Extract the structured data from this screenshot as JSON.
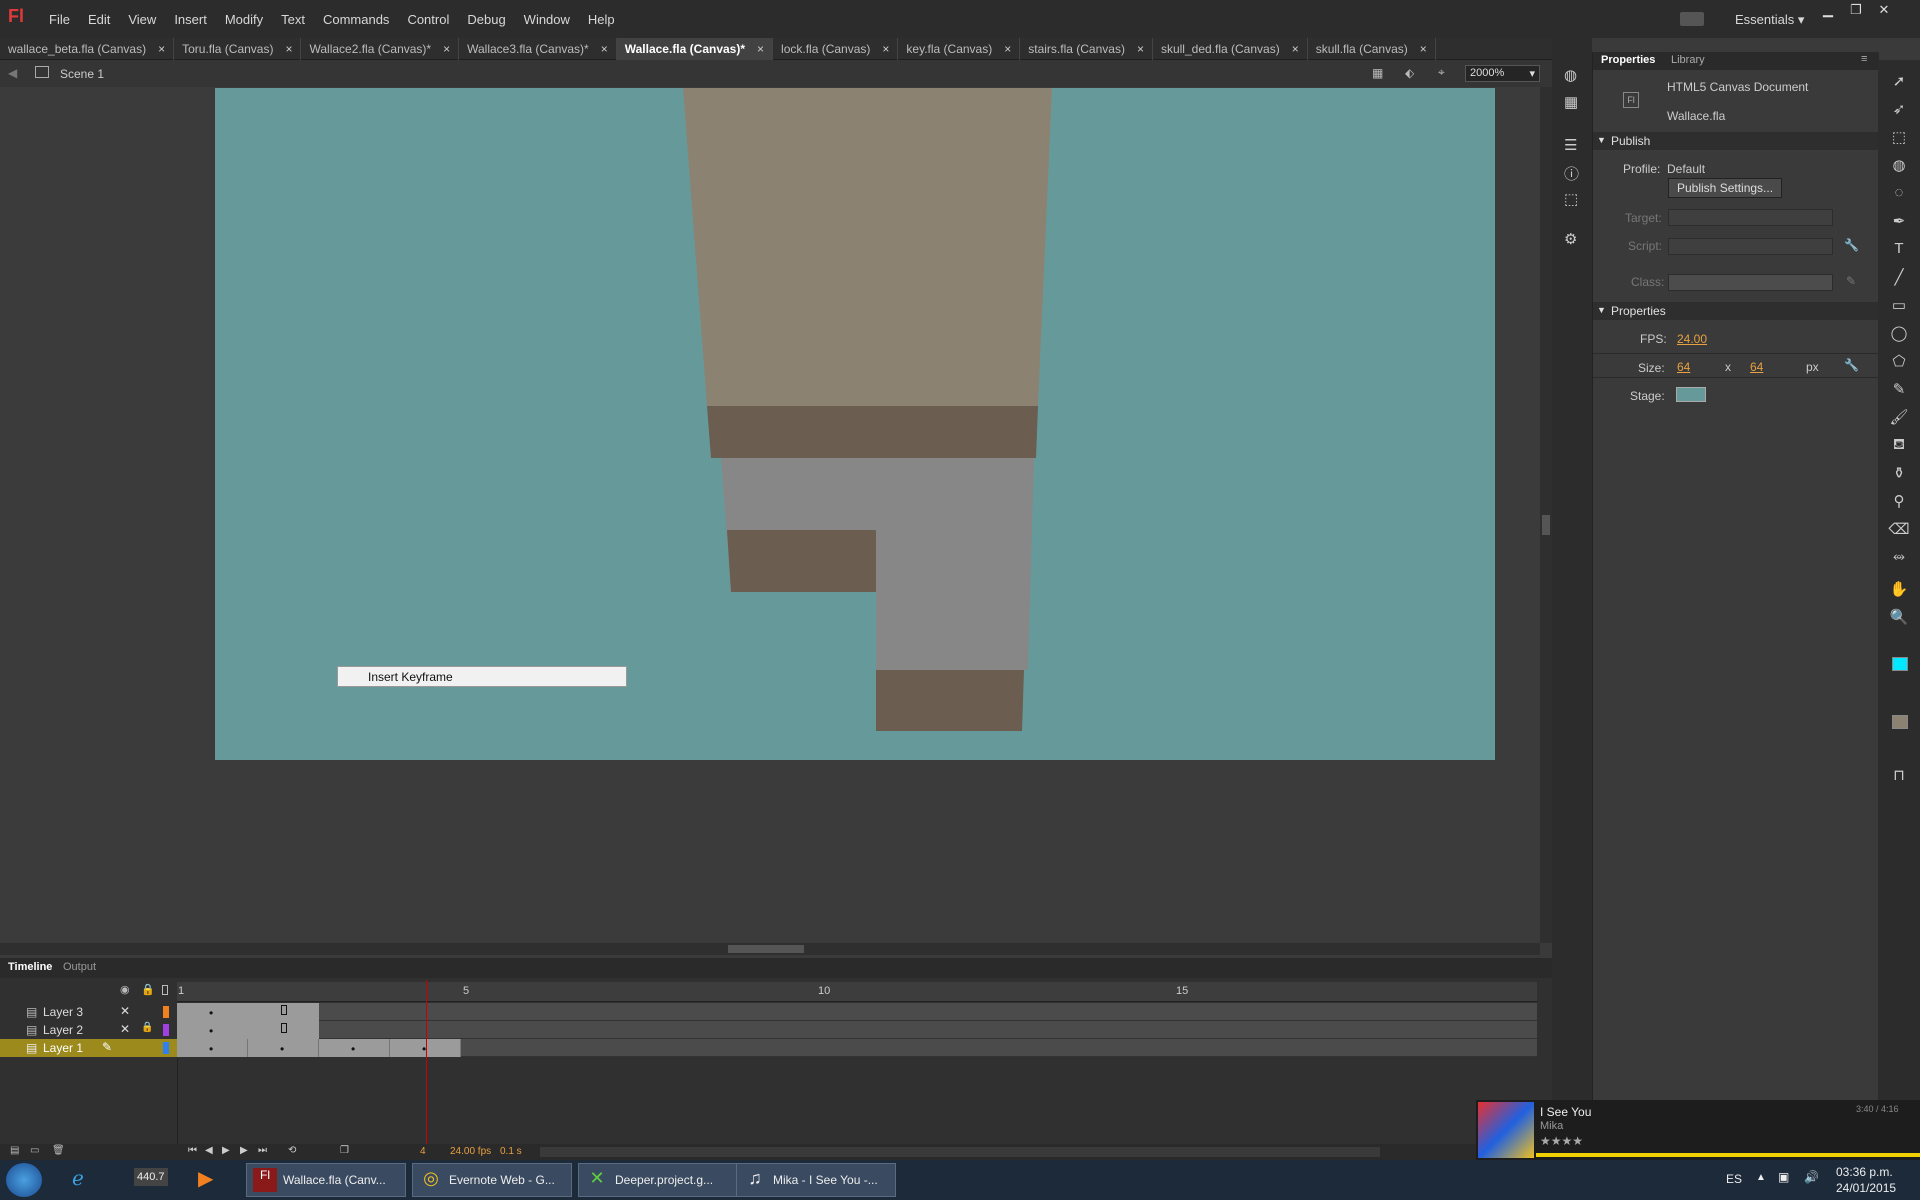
{
  "app": {
    "logo": "Fl",
    "workspace": "Essentials"
  },
  "menus": [
    "File",
    "Edit",
    "View",
    "Insert",
    "Modify",
    "Text",
    "Commands",
    "Control",
    "Debug",
    "Window",
    "Help"
  ],
  "tabs": [
    {
      "label": "wallace_beta.fla (Canvas)"
    },
    {
      "label": "Toru.fla (Canvas)"
    },
    {
      "label": "Wallace2.fla (Canvas)*"
    },
    {
      "label": "Wallace3.fla (Canvas)*"
    },
    {
      "label": "Wallace.fla (Canvas)*",
      "active": true
    },
    {
      "label": "lock.fla (Canvas)"
    },
    {
      "label": "key.fla (Canvas)"
    },
    {
      "label": "stairs.fla (Canvas)"
    },
    {
      "label": "skull_ded.fla (Canvas)"
    },
    {
      "label": "skull.fla (Canvas)"
    }
  ],
  "tab_close": "×",
  "editbar": {
    "scene": "Scene 1",
    "zoom": "2000%"
  },
  "context_menu": {
    "item": "Insert Keyframe"
  },
  "colors": {
    "stage": "#669a9a",
    "tan": "#8c8272",
    "brown": "#6b5d4f",
    "gray": "#878787"
  },
  "timeline": {
    "tabs": [
      "Timeline",
      "Output"
    ],
    "ruler": [
      "1",
      "5",
      "10",
      "15"
    ],
    "layers": [
      "Layer 3",
      "Layer 2",
      "Layer 1"
    ],
    "current_frame": "4",
    "fps": "24.00 fps",
    "time": "0.1 s"
  },
  "panel": {
    "tabs": [
      "Properties",
      "Library"
    ],
    "doc_type": "HTML5 Canvas Document",
    "doc_name": "Wallace.fla",
    "doc_icon": "Fl",
    "publish_header": "Publish",
    "profile_label": "Profile:",
    "profile_value": "Default",
    "publish_settings": "Publish Settings...",
    "target_label": "Target:",
    "script_label": "Script:",
    "class_label": "Class:",
    "properties_header": "Properties",
    "fps_label": "FPS:",
    "fps_value": "24.00",
    "size_label": "Size:",
    "width": "64",
    "x": "x",
    "height": "64",
    "px": "px",
    "stage_label": "Stage:"
  },
  "music": {
    "title": "I See You",
    "artist": "Mika",
    "time": "3:40 / 4:16",
    "stars": "★★★★"
  },
  "taskbar": {
    "items": [
      "Wallace.fla (Canv...",
      "Evernote Web - G...",
      "Deeper.project.g...",
      "Mika - I See You -..."
    ],
    "quick_label": "440.7",
    "lang": "ES",
    "time": "03:36 p.m.",
    "date": "24/01/2015"
  }
}
